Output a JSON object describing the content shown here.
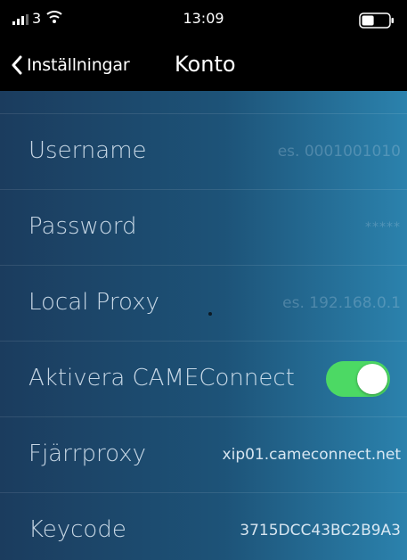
{
  "status_bar": {
    "carrier": "3",
    "time": "13:09",
    "battery_level": 0.45
  },
  "nav": {
    "back_label": "Inställningar",
    "title": "Konto"
  },
  "fields": {
    "username": {
      "label": "Username",
      "placeholder": "es. 0001001010"
    },
    "password": {
      "label": "Password",
      "placeholder": "*****"
    },
    "local_proxy": {
      "label": "Local Proxy",
      "placeholder": "es. 192.168.0.1"
    },
    "cameconnect": {
      "label": "Aktivera CAMEConnect",
      "enabled": true
    },
    "remote_proxy": {
      "label": "Fjärrproxy",
      "value": "xip01.cameconnect.net"
    },
    "keycode": {
      "label": "Keycode",
      "value": "3715DCC43BC2B9A3"
    }
  },
  "colors": {
    "toggle_on": "#4cd964",
    "background_start": "#1b3c5e",
    "background_end": "#2b82ad"
  }
}
